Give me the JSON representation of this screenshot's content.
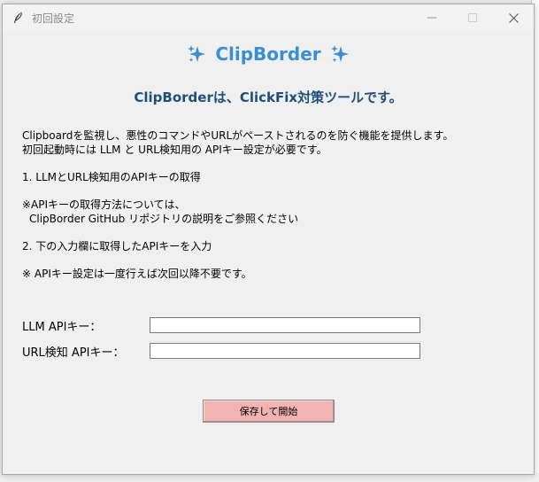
{
  "window": {
    "title": "初回設定",
    "icon": "quill-icon"
  },
  "header": {
    "app_title": "ClipBorder",
    "sparkle_icon": "sparkles-icon",
    "accent_color": "#3a8fd0",
    "subtitle": "ClipBorderは、ClickFix対策ツールです。",
    "subtitle_color": "#1f4e79"
  },
  "description": {
    "lines": [
      "Clipboardを監視し、悪性のコマンドやURLがペーストされるのを防ぐ機能を提供します。",
      "初回起動時には LLM と URL検知用の APIキー設定が必要です。",
      "1. LLMとURL検知用のAPIキーの取得",
      "※APIキーの取得方法については、",
      "ClipBorder GitHub リポジトリの説明をご参照ください",
      "2. 下の入力欄に取得したAPIキーを入力",
      "※ APIキー設定は一度行えば次回以降不要です。"
    ]
  },
  "form": {
    "llm_label": "LLM APIキー：",
    "llm_value": "",
    "url_label": "URL検知 APIキー：",
    "url_value": ""
  },
  "actions": {
    "save_label": "保存して開始",
    "save_color": "#f2b4b0"
  }
}
